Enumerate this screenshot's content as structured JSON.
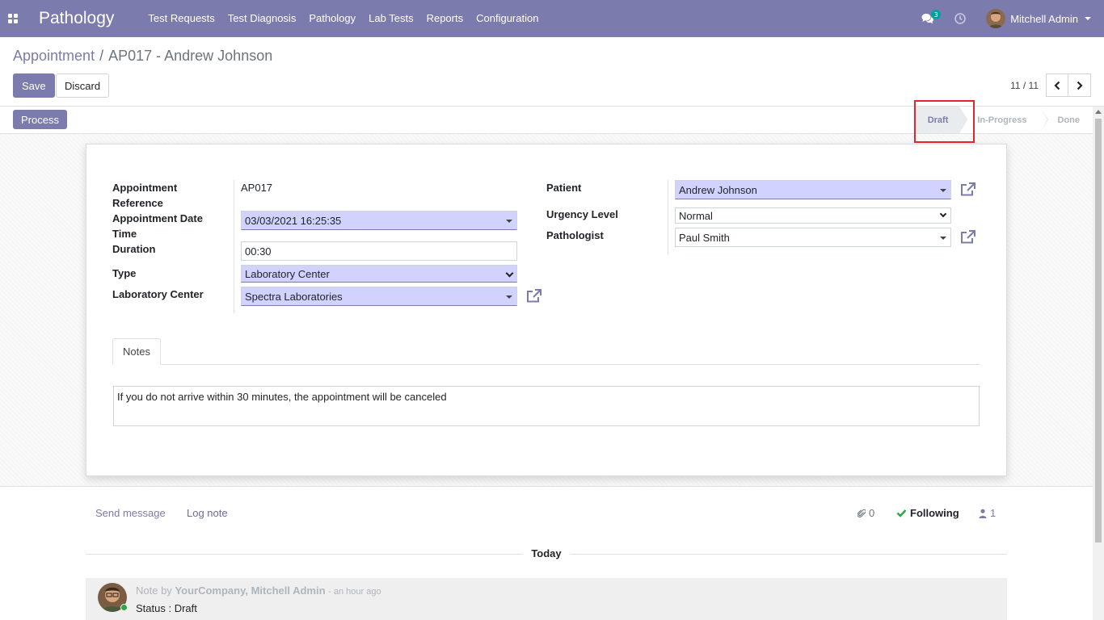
{
  "navbar": {
    "brand": "Pathology",
    "menu": [
      "Test Requests",
      "Test Diagnosis",
      "Pathology",
      "Lab Tests",
      "Reports",
      "Configuration"
    ],
    "chat_badge": "3",
    "user_name": "Mitchell Admin",
    "color": "#7c7bad"
  },
  "breadcrumb": {
    "parent": "Appointment",
    "separator": "/",
    "current": "AP017 - Andrew Johnson"
  },
  "buttons": {
    "save": "Save",
    "discard": "Discard",
    "process": "Process"
  },
  "pager": {
    "value": "11 / 11"
  },
  "stages": [
    {
      "label": "Draft",
      "current": true
    },
    {
      "label": "In-Progress",
      "current": false
    },
    {
      "label": "Done",
      "current": false
    }
  ],
  "form": {
    "left": {
      "reference_label": "Appointment Reference",
      "reference_label_1": "Appointment",
      "reference_label_2": "Reference",
      "reference_value": "AP017",
      "date_label_1": "Appointment Date",
      "date_label_2": "Time",
      "date_value": "03/03/2021 16:25:35",
      "duration_label": "Duration",
      "duration_value": "00:30",
      "type_label": "Type",
      "type_value": "Laboratory Center",
      "lab_label": "Laboratory Center",
      "lab_value": "Spectra Laboratories"
    },
    "right": {
      "patient_label": "Patient",
      "patient_value": "Andrew Johnson",
      "urgency_label": "Urgency Level",
      "urgency_value": "Normal",
      "pathologist_label": "Pathologist",
      "pathologist_value": "Paul Smith"
    }
  },
  "tabs": {
    "notes_label": "Notes",
    "notes_text": "If you do not arrive within 30 minutes, the appointment will be canceled"
  },
  "chatter": {
    "send_message": "Send message",
    "log_note": "Log note",
    "attachments": "0",
    "following": "Following",
    "followers": "1",
    "today": "Today",
    "message": {
      "kind": "Note by",
      "author": "YourCompany, Mitchell Admin",
      "time": "- an hour ago",
      "body": "Status : Draft"
    }
  }
}
